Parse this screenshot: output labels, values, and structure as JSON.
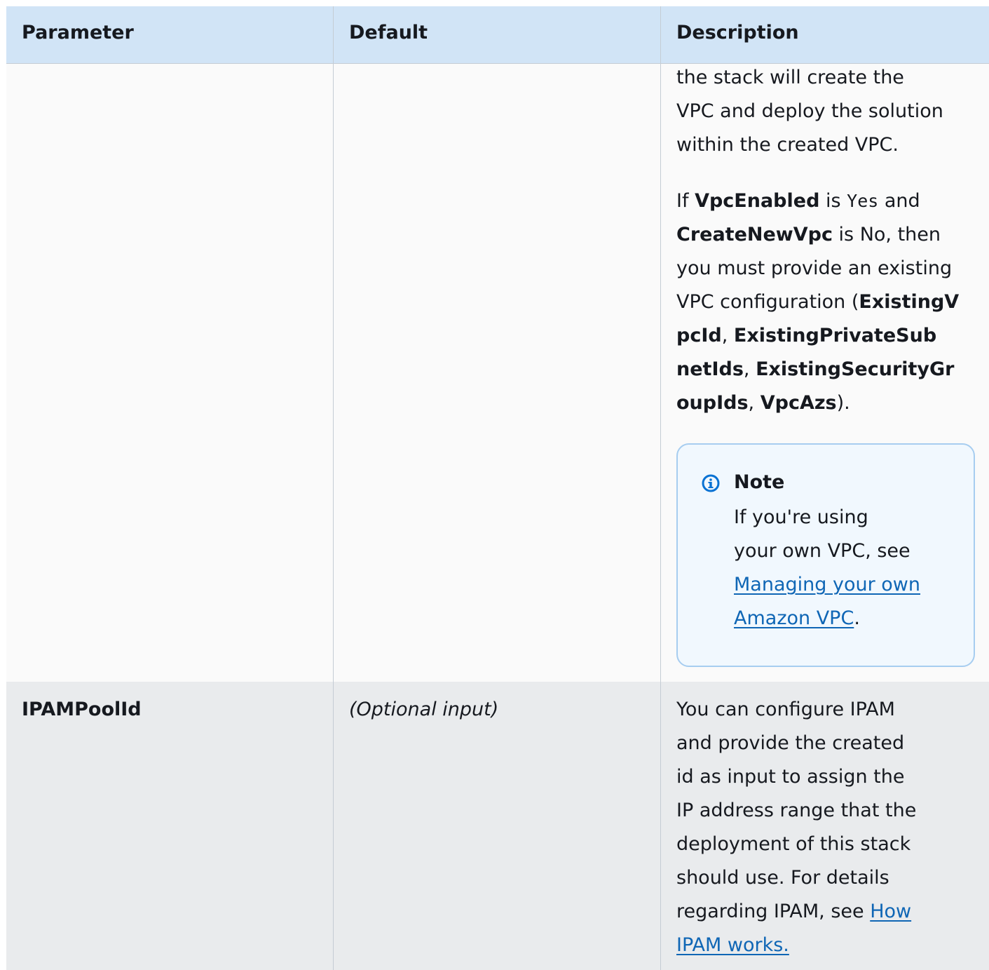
{
  "header": {
    "parameter": "Parameter",
    "default": "Default",
    "description": "Description"
  },
  "row1": {
    "line1": "the stack will create the",
    "line2": "VPC and deploy the solution",
    "line3": "within the created VPC.",
    "p2": {
      "if": "If ",
      "vpc_enabled": "VpcEnabled",
      "is1": " is ",
      "yes": "Yes",
      "and": " and",
      "create_new_vpc": "CreateNewVpc",
      "is2": " is No, then",
      "must": "you must provide an existing",
      "config": "VPC configuration (",
      "p_vpc_id_a": "ExistingV",
      "p_vpc_id_b": "pcId",
      "comma1": ", ",
      "p_subnets_a": "ExistingPrivateSub",
      "p_subnets_b": "netIds",
      "comma2": ", ",
      "p_sg_a": "ExistingSecurityGr",
      "p_sg_b": "oupIds",
      "comma3": ", ",
      "p_azs": "VpcAzs",
      "close": ")."
    },
    "note": {
      "title": "Note",
      "line1": "If you're using",
      "line2": "your own VPC, see",
      "link1": "Managing your own",
      "link2": "Amazon VPC",
      "period": "."
    }
  },
  "row2": {
    "parameter": "IPAMPoolId",
    "default": "(Optional input)",
    "desc_lines": [
      "You can configure IPAM",
      "and provide the created",
      "id as input to assign the",
      "IP address range that the",
      "deployment of this stack",
      "should use. For details"
    ],
    "desc_last_prefix": "regarding IPAM, see ",
    "link1": "How",
    "link2": "IPAM works."
  }
}
